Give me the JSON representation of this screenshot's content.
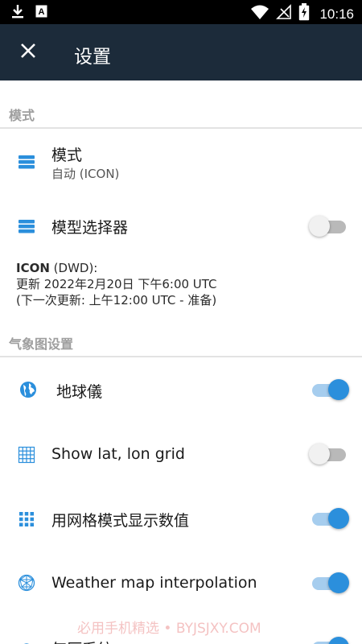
{
  "status_bar": {
    "left_icons": [
      "download-icon",
      "text-a-icon"
    ],
    "right_icons": [
      "wifi-icon",
      "no-signal-icon",
      "battery-charging-icon"
    ],
    "time": "10:16"
  },
  "app_bar": {
    "close_icon": "close-icon",
    "title": "设置"
  },
  "sections": {
    "mode": {
      "header": "模式"
    },
    "weather_map": {
      "header": "气象图设置"
    }
  },
  "rows": {
    "mode": {
      "title": "模式",
      "subtitle": "自动 (ICON)",
      "icon": "layers-icon"
    },
    "model_selector": {
      "title": "模型选择器",
      "icon": "layers-icon",
      "switch_on": false
    },
    "globe": {
      "title": "地球儀",
      "icon": "globe-icon",
      "switch_on": true
    },
    "lat_lon_grid": {
      "title": "Show lat, lon grid",
      "icon": "grid-icon",
      "switch_on": false
    },
    "grid_values": {
      "title": "用网格模式显示数值",
      "icon": "dots-grid-icon",
      "switch_on": true
    },
    "interpolation": {
      "title": "Weather map interpolation",
      "icon": "mesh-sphere-icon",
      "switch_on": true
    },
    "pressure_system": {
      "title": "气压系统",
      "icon": "pressure-icon",
      "switch_on": true
    }
  },
  "model_info": {
    "model_name": "ICON",
    "model_source": " (DWD):",
    "updated": "更新 2022年2月20日 下午6:00 UTC",
    "next_update": "(下一次更新: 上午12:00 UTC - 准备)"
  },
  "watermark": "必用手机精选 • BYJSJXY.COM",
  "colors": {
    "app_bar": "#1c2b3a",
    "accent": "#2b8fdc",
    "section_header": "#9e9e9e"
  }
}
